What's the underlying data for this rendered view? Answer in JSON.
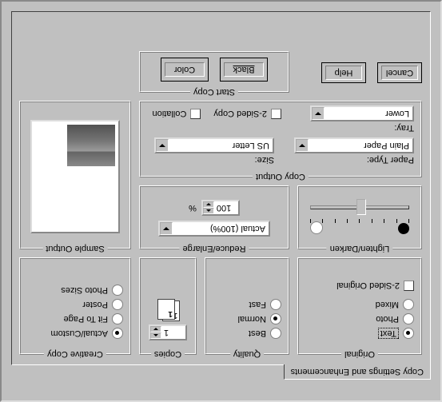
{
  "tab_label": "Copy Settings and Enhancements",
  "buttons": {
    "cancel": "Cancel",
    "help": "Help",
    "black": "Black",
    "color": "Color"
  },
  "start_copy": {
    "title": "Start Copy"
  },
  "copy_output": {
    "title": "Copy Output",
    "tray_label": "Tray:",
    "tray_value": "Lower",
    "paper_type_label": "Paper Type:",
    "paper_type_value": "Plain Paper",
    "size_label": "Size:",
    "size_value": "US Letter",
    "two_sided_copy": "2-Sided Copy",
    "collation": "Collation"
  },
  "lighten_darken": {
    "title": "Lighten/Darken"
  },
  "reduce_enlarge": {
    "title": "Reduce/Enlarge",
    "preset": "Actual (100%)",
    "percent": "100",
    "percent_suffix": "%"
  },
  "original": {
    "title": "Original",
    "text": "Text",
    "photo": "Photo",
    "mixed": "Mixed",
    "two_sided": "2-Sided Original"
  },
  "quality": {
    "title": "Quality",
    "best": "Best",
    "normal": "Normal",
    "fast": "Fast"
  },
  "copies": {
    "title": "Copies",
    "value": "1"
  },
  "sample_output": {
    "title": "Sample Output"
  },
  "creative_copy": {
    "title": "Creative Copy",
    "actual_custom": "Actual/Custom",
    "fit_to_page": "Fit To Page",
    "poster": "Poster",
    "photo_sizes": "Photo Sizes"
  }
}
